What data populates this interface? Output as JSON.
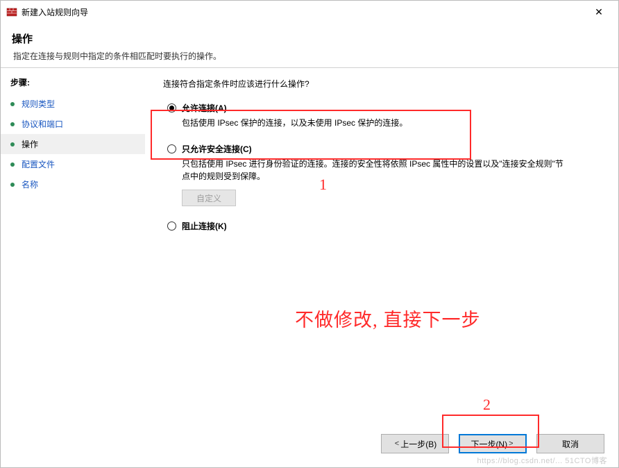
{
  "window": {
    "title": "新建入站规则向导",
    "close_glyph": "✕"
  },
  "header": {
    "heading": "操作",
    "sub": "指定在连接与规则中指定的条件相匹配时要执行的操作。"
  },
  "sidebar": {
    "steps_header": "步骤:",
    "items": [
      {
        "label": "规则类型"
      },
      {
        "label": "协议和端口"
      },
      {
        "label": "操作"
      },
      {
        "label": "配置文件"
      },
      {
        "label": "名称"
      }
    ],
    "current_index": 2
  },
  "content": {
    "question": "连接符合指定条件时应该进行什么操作?",
    "options": [
      {
        "label": "允许连接(A)",
        "desc": "包括使用 IPsec 保护的连接，以及未使用 IPsec 保护的连接。",
        "checked": true
      },
      {
        "label": "只允许安全连接(C)",
        "desc": "只包括使用 IPsec 进行身份验证的连接。连接的安全性将依照 IPsec 属性中的设置以及\"连接安全规则\"节点中的规则受到保障。",
        "checked": false,
        "custom_button": "自定义"
      },
      {
        "label": "阻止连接(K)",
        "desc": "",
        "checked": false
      }
    ]
  },
  "annotations": {
    "marker1": "1",
    "marker2": "2",
    "note": "不做修改, 直接下一步"
  },
  "footer": {
    "back": "上一步(B)",
    "next": "下一步(N)",
    "cancel": "取消",
    "back_chev": "<",
    "next_chev": ">"
  },
  "watermark": "https://blog.csdn.net/... 51CTO博客"
}
